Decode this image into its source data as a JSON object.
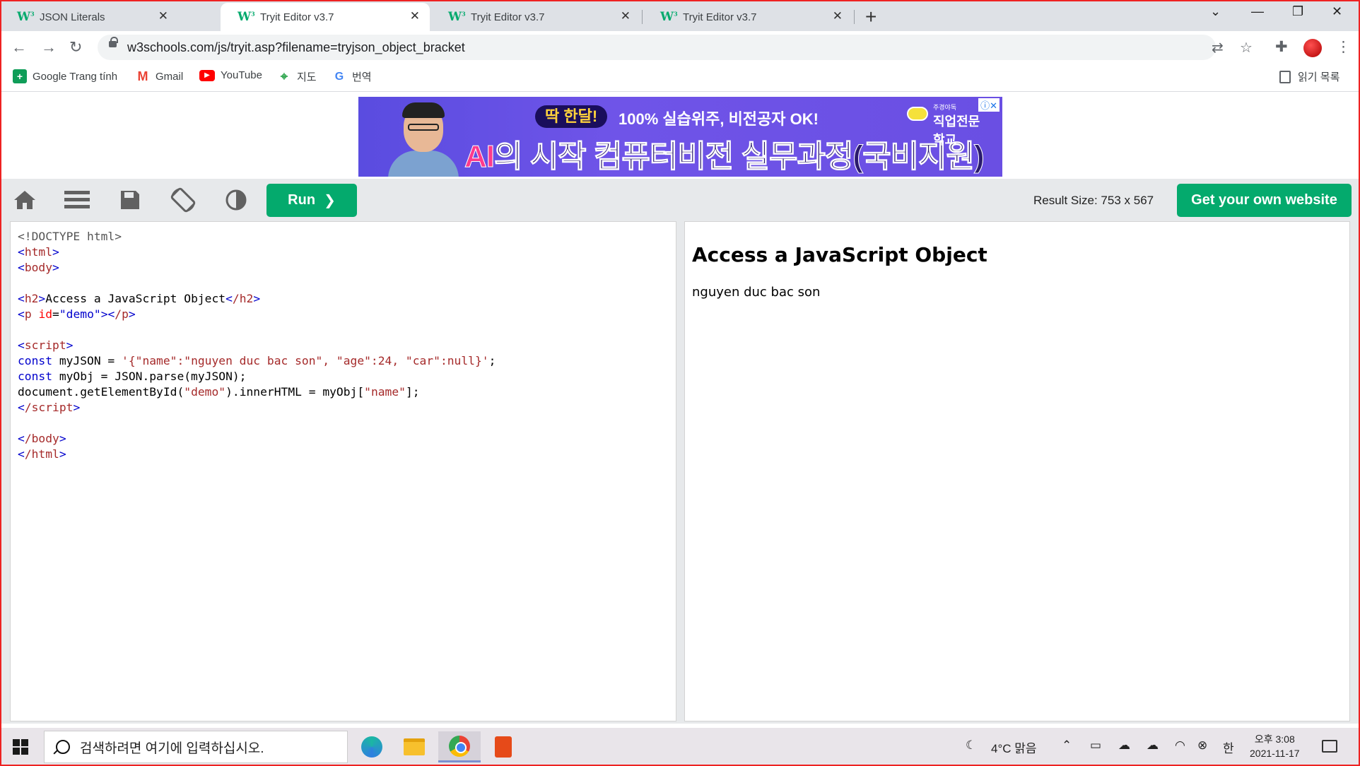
{
  "tabs": [
    {
      "title": "JSON Literals",
      "active": false
    },
    {
      "title": "Tryit Editor v3.7",
      "active": true
    },
    {
      "title": "Tryit Editor v3.7",
      "active": false
    },
    {
      "title": "Tryit Editor v3.7",
      "active": false
    }
  ],
  "address_bar": {
    "url": "w3schools.com/js/tryit.asp?filename=tryjson_object_bracket"
  },
  "bookmarks": [
    {
      "label": "Google Trang tính",
      "icon": "sheets-icon"
    },
    {
      "label": "Gmail",
      "icon": "gmail-icon"
    },
    {
      "label": "YouTube",
      "icon": "youtube-icon"
    },
    {
      "label": "지도",
      "icon": "maps-icon"
    },
    {
      "label": "번역",
      "icon": "translate-icon"
    }
  ],
  "reading_list": "읽기 목록",
  "ad": {
    "pill": "딱 한달!",
    "sub": "100% 실습위주, 비전공자 OK!",
    "headline_ai": "AI",
    "headline_rest": "의 시작 컴퓨터비전 실무과정(국비지원)",
    "school_small": "주경야독",
    "school": "직업전문학교"
  },
  "tryit": {
    "run_label": "Run",
    "result_size": "Result Size: 753 x 567",
    "own_website_label": "Get your own website"
  },
  "result": {
    "heading": "Access a JavaScript Object",
    "paragraph": "nguyen duc bac son"
  },
  "taskbar": {
    "search_placeholder": "검색하려면 여기에 입력하십시오.",
    "weather": "4°C  맑음",
    "ime": "한",
    "time": "오후 3:08",
    "date": "2021-11-17"
  },
  "colors": {
    "w3_green": "#04aa6d",
    "tab_strip": "#dee1e6",
    "tryit_bar": "#e7e9eb",
    "tag": "#a52a2a",
    "bracket": "#0000cd",
    "attr": "#ff0000"
  }
}
